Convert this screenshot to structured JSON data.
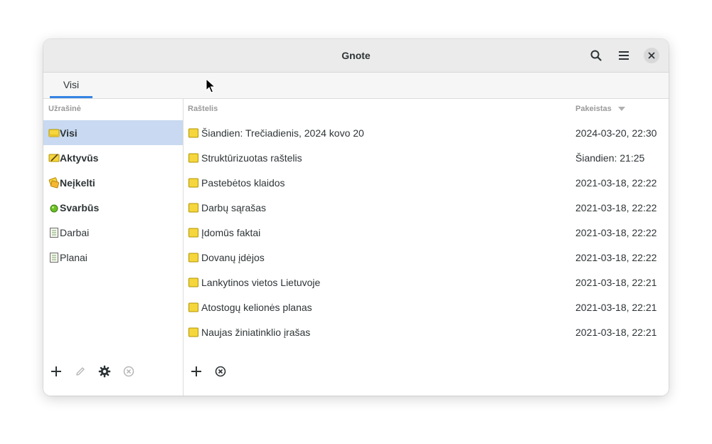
{
  "window": {
    "title": "Gnote"
  },
  "headerbar": {
    "icons": [
      "search-icon",
      "hamburger-menu-icon",
      "close-icon"
    ]
  },
  "tabs": [
    {
      "label": "Visi",
      "active": true
    }
  ],
  "sidebar": {
    "header": "Užrašinė",
    "items": [
      {
        "label": "Visi",
        "icon": "all-notes-icon",
        "selected": true,
        "bold": true
      },
      {
        "label": "Aktyvūs",
        "icon": "active-notes-icon",
        "bold": true
      },
      {
        "label": "Neįkelti",
        "icon": "unfiled-notes-icon",
        "bold": true
      },
      {
        "label": "Svarbūs",
        "icon": "important-icon",
        "bold": true
      },
      {
        "label": "Darbai",
        "icon": "notebook-icon",
        "bold": false
      },
      {
        "label": "Planai",
        "icon": "notebook-icon",
        "bold": false
      }
    ],
    "footer_icons": [
      "add-icon",
      "edit-icon",
      "settings-icon",
      "delete-icon"
    ]
  },
  "notes": {
    "header_name": "Raštelis",
    "header_modified": "Pakeistas",
    "rows": [
      {
        "name": "Šiandien: Trečiadienis, 2024 kovo 20",
        "modified": "2024-03-20, 22:30"
      },
      {
        "name": "Struktūrizuotas raštelis",
        "modified": "Šiandien: 21:25"
      },
      {
        "name": "Pastebėtos klaidos",
        "modified": "2021-03-18, 22:22"
      },
      {
        "name": "Darbų sąrašas",
        "modified": "2021-03-18, 22:22"
      },
      {
        "name": "Įdomūs faktai",
        "modified": "2021-03-18, 22:22"
      },
      {
        "name": "Dovanų įdėjos",
        "modified": "2021-03-18, 22:22"
      },
      {
        "name": "Lankytinos vietos Lietuvoje",
        "modified": "2021-03-18, 22:21"
      },
      {
        "name": "Atostogų kelionės planas",
        "modified": "2021-03-18, 22:21"
      },
      {
        "name": "Naujas žiniatinklio įrašas",
        "modified": "2021-03-18, 22:21"
      }
    ],
    "footer_icons": [
      "add-icon",
      "delete-icon"
    ]
  },
  "colors": {
    "accent": "#3584e4",
    "selection": "#c8d9f1",
    "note_yellow": "#f5d63d"
  }
}
